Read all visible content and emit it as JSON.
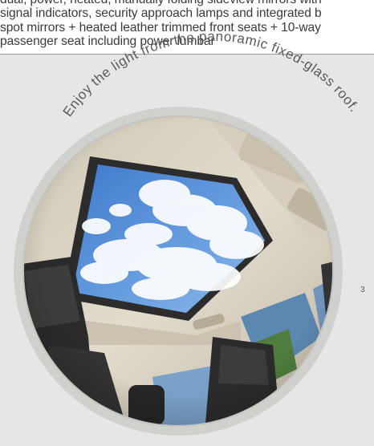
{
  "description": {
    "lines": [
      "dual, power, heated, manually folding sideview mirrors with",
      "signal indicators, security approach lamps and integrated b",
      "spot mirrors + heated leather trimmed front seats + 10-way",
      "passenger seat including power lumbar"
    ]
  },
  "photo": {
    "caption": "Enjoy the light from the panoramic fixed-glass roof.",
    "footnote": "3"
  },
  "colors": {
    "panel": "#e6e6e4",
    "ring": "#d0d0cd",
    "sky": "#5a8fd6",
    "headliner": "#d9d2c2",
    "text": "#3a3a3a"
  }
}
